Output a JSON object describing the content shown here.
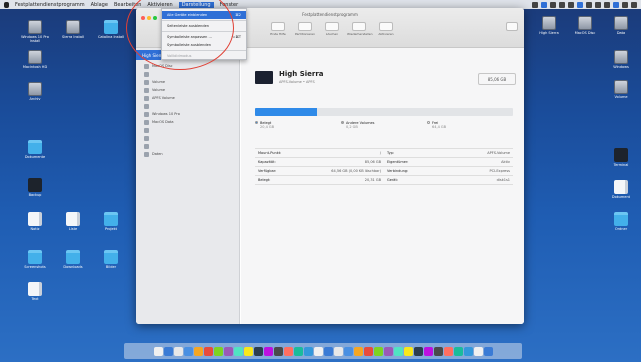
{
  "menubar": {
    "items": [
      "Festplattendienstprogramm",
      "Ablage",
      "Bearbeiten",
      "Aktivieren",
      "Darstellung",
      "Fenster"
    ],
    "active_index": 4,
    "status_count": 12
  },
  "menu": {
    "items": [
      {
        "label": "Alle Geräte einblenden",
        "shortcut": "⌘2",
        "state": "selected"
      },
      {
        "label": "Seitenleiste ausblenden",
        "shortcut": "",
        "state": "normal"
      },
      {
        "label": "Symbolleiste anpassen …",
        "shortcut": "⌥⌘T",
        "state": "normal"
      },
      {
        "label": "Symbolleiste ausblenden",
        "shortcut": "",
        "state": "normal"
      },
      {
        "label": "Vollbildmodus",
        "shortcut": "",
        "state": "disabled"
      }
    ]
  },
  "window": {
    "title": "Festplattendienstprogramm",
    "toolbar": [
      "Erste Hilfe",
      "Partitionieren",
      "Löschen",
      "Wiederherstellen",
      "Aktivieren"
    ],
    "sidebar": {
      "header": "High Sierra",
      "items": [
        {
          "label": "MacOS Disc",
          "dim": false
        },
        {
          "label": "",
          "dim": true
        },
        {
          "label": "Volume",
          "dim": false
        },
        {
          "label": "Volume",
          "dim": false
        },
        {
          "label": "APFS Volume",
          "dim": false
        },
        {
          "label": "",
          "dim": true
        },
        {
          "label": "Windows 10 Pro",
          "dim": false
        },
        {
          "label": "MacOS Data",
          "dim": false
        },
        {
          "label": "",
          "dim": true
        },
        {
          "label": "",
          "dim": true
        },
        {
          "label": "",
          "dim": true
        },
        {
          "label": "Daten",
          "dim": false
        }
      ]
    },
    "volume": {
      "name": "High Sierra",
      "subtitle": "APFS-Volume • APFS",
      "capacity": "85,06 GB",
      "used_fraction": 0.24
    },
    "legend": [
      {
        "label": "Belegt",
        "value": "20,4 GB",
        "color": "#2f8ae8"
      },
      {
        "label": "Andere Volumes",
        "value": "0,2 GB",
        "color": "#a8abb0"
      },
      {
        "label": "Frei",
        "value": "64,4 GB",
        "color": "#ffffff"
      }
    ],
    "details": [
      [
        "Mount-Punkt:",
        "/",
        "Typ:",
        "APFS-Volume"
      ],
      [
        "Kapazität:",
        "85,06 GB",
        "Eigentümer:",
        "Aktiv"
      ],
      [
        "Verfügbar:",
        "64,56 GB (0,00 KB löschbar)",
        "Verbindung:",
        "PCI-Express"
      ],
      [
        "Belegt:",
        "20,31 GB",
        "Gerät:",
        "disk1s1"
      ]
    ]
  },
  "desktop": {
    "left_icons": [
      {
        "label": "Windows 10 Pro Install",
        "kind": "hdd"
      },
      {
        "label": "Sierra Install",
        "kind": "hdd"
      },
      {
        "label": "Catalina Install",
        "kind": "folder"
      },
      {
        "label": "Macintosh HD",
        "kind": "hdd"
      },
      {
        "label": "Archiv",
        "kind": "hdd"
      },
      {
        "label": "Dokumente",
        "kind": "folder"
      },
      {
        "label": "Backup",
        "kind": "dark"
      },
      {
        "label": "Notiz",
        "kind": "doc"
      },
      {
        "label": "Liste",
        "kind": "doc"
      },
      {
        "label": "Projekt",
        "kind": "folder"
      },
      {
        "label": "Screenshots",
        "kind": "folder"
      },
      {
        "label": "Downloads",
        "kind": "folder"
      },
      {
        "label": "Bilder",
        "kind": "folder"
      },
      {
        "label": "Text",
        "kind": "doc"
      }
    ],
    "right_icons": [
      {
        "label": "High Sierra",
        "kind": "hdd"
      },
      {
        "label": "MacOS Disc",
        "kind": "hdd"
      },
      {
        "label": "Data",
        "kind": "hdd"
      },
      {
        "label": "Windows",
        "kind": "hdd"
      },
      {
        "label": "Volume",
        "kind": "hdd"
      },
      {
        "label": "Terminal",
        "kind": "dark"
      },
      {
        "label": "Dokument",
        "kind": "doc"
      },
      {
        "label": "Ordner",
        "kind": "folder"
      }
    ],
    "top_icons": [
      {
        "label": "",
        "kind": "hdd"
      },
      {
        "label": "",
        "kind": "doc"
      },
      {
        "label": "",
        "kind": "doc"
      },
      {
        "label": "",
        "kind": "doc"
      },
      {
        "label": "",
        "kind": "doc"
      }
    ]
  },
  "dock": {
    "count": 34
  },
  "colors": {
    "accent": "#2f6fd6",
    "annotation": "#e04136"
  }
}
